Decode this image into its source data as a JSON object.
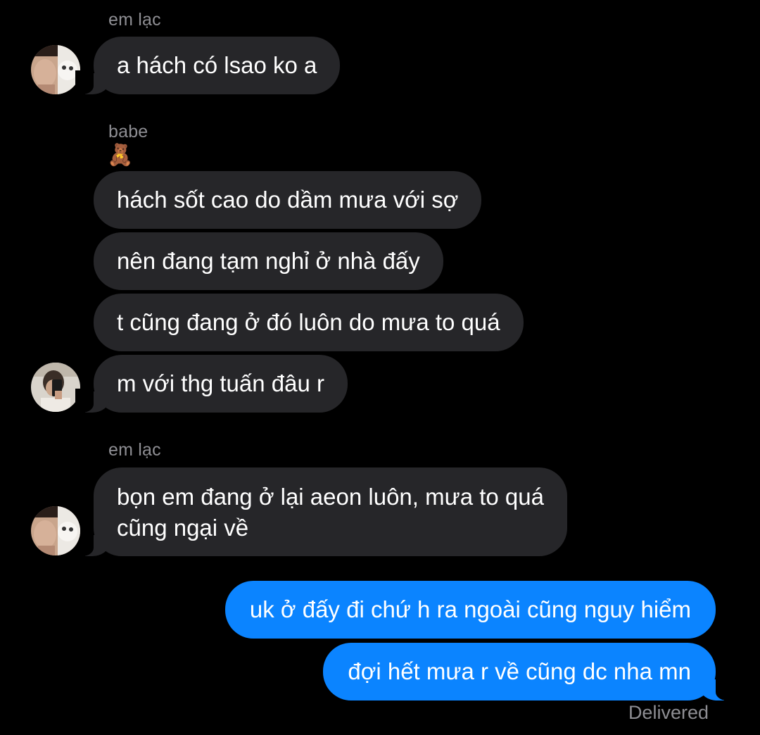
{
  "thread": {
    "groups": [
      {
        "sender": "em lạc",
        "messages": [
          "a hách có lsao ko a"
        ]
      },
      {
        "sender": "babe",
        "sender_emoji": "🧸",
        "messages": [
          "hách sốt cao do dầm mưa với sợ",
          "nên đang tạm nghỉ ở nhà đấy",
          "t cũng đang ở đó luôn do mưa to quá",
          "m với thg tuấn đâu r"
        ]
      },
      {
        "sender": "em lạc",
        "messages": [
          "bọn em đang ở lại aeon luôn, mưa to quá",
          "cũng ngại về"
        ]
      }
    ],
    "outgoing": [
      "uk ở đấy đi chứ h ra ngoài cũng nguy hiểm",
      "đợi hết mưa r về cũng dc nha mn"
    ],
    "status": "Delivered"
  },
  "colors": {
    "background": "#000000",
    "incoming_bubble": "#262629",
    "outgoing_bubble": "#0b84ff",
    "meta_text": "#8e8e93"
  }
}
